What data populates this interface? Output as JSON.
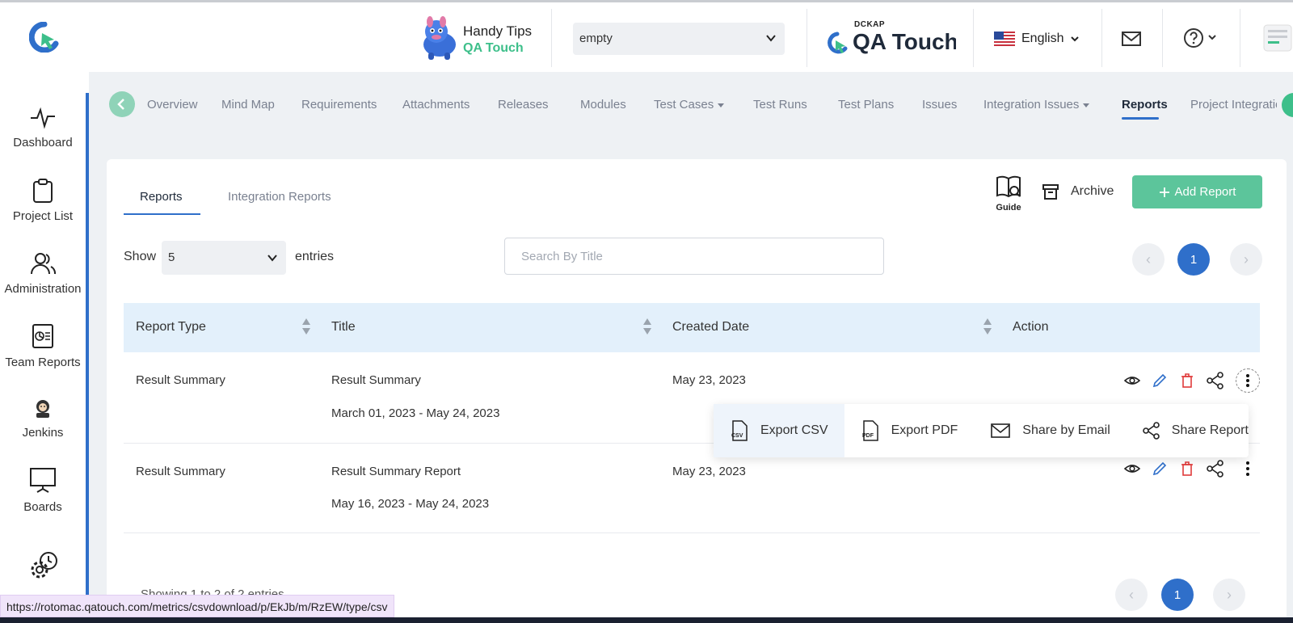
{
  "header": {
    "tips_line1": "Handy Tips",
    "tips_line2": "QA Touch",
    "project_select": "empty",
    "brand_top": "DCKAP",
    "brand_name": "QA Touch",
    "language": "English"
  },
  "sidebar": {
    "items": [
      {
        "label": "Dashboard",
        "icon": "pulse-icon"
      },
      {
        "label": "Project List",
        "icon": "clipboard-icon"
      },
      {
        "label": "Administration",
        "icon": "users-icon"
      },
      {
        "label": "Team Reports",
        "icon": "report-icon"
      },
      {
        "label": "Jenkins",
        "icon": "jenkins-icon"
      },
      {
        "label": "Boards",
        "icon": "board-icon"
      },
      {
        "label": "",
        "icon": "gear-icon"
      }
    ]
  },
  "tabs": [
    {
      "label": "Overview"
    },
    {
      "label": "Mind Map"
    },
    {
      "label": "Requirements"
    },
    {
      "label": "Attachments"
    },
    {
      "label": "Releases"
    },
    {
      "label": "Modules"
    },
    {
      "label": "Test Cases"
    },
    {
      "label": "Test Runs"
    },
    {
      "label": "Test Plans"
    },
    {
      "label": "Issues"
    },
    {
      "label": "Integration Issues"
    },
    {
      "label": "Reports"
    },
    {
      "label": "Project Integratio"
    }
  ],
  "subtabs": {
    "reports": "Reports",
    "integration": "Integration Reports"
  },
  "toolbar": {
    "guide_label": "Guide",
    "archive_label": "Archive",
    "add_report_label": "Add Report"
  },
  "controls": {
    "show_label": "Show",
    "entries_value": "5",
    "entries_label": "entries",
    "search_placeholder": "Search By Title",
    "current_page": "1"
  },
  "table": {
    "headers": [
      "Report Type",
      "Title",
      "Created Date",
      "Action"
    ],
    "rows": [
      {
        "type": "Result Summary",
        "title": "Result Summary",
        "range": "March 01, 2023 - May 24, 2023",
        "date": "May 23, 2023"
      },
      {
        "type": "Result Summary",
        "title": "Result Summary Report",
        "range": "May 16, 2023 - May 24, 2023",
        "date": "May 23, 2023"
      }
    ]
  },
  "dropdown": {
    "export_csv": "Export CSV",
    "export_pdf": "Export PDF",
    "share_email": "Share by Email",
    "share_report": "Share Report"
  },
  "footer": {
    "showing": "Showing 1 to 2 of 2 entries",
    "current_page": "1"
  },
  "status_url": "https://rotomac.qatouch.com/metrics/csvdownload/p/EkJb/m/RzEW/type/csv"
}
